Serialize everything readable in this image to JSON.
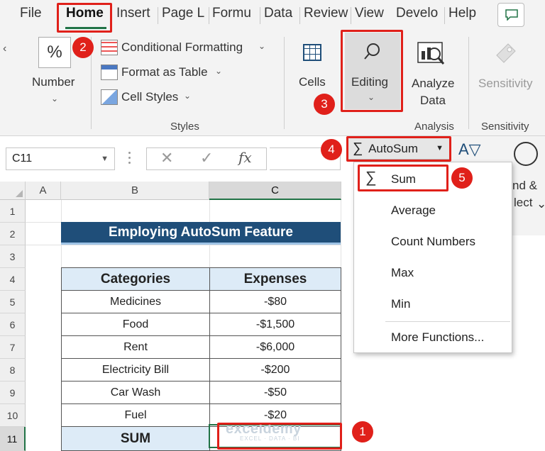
{
  "ribbon_tabs": [
    "File",
    "Home",
    "Insert",
    "Page L",
    "Formu",
    "Data",
    "Review",
    "View",
    "Develo",
    "Help"
  ],
  "ribbon": {
    "number_symbol": "%",
    "number_label": "Number",
    "conditional_formatting": "Conditional Formatting",
    "format_as_table": "Format as Table",
    "cell_styles": "Cell Styles",
    "styles_group": "Styles",
    "cells_label": "Cells",
    "editing_label": "Editing",
    "analyze_label_1": "Analyze",
    "analyze_label_2": "Data",
    "analysis_group": "Analysis",
    "sensitivity_label": "Sensitivity",
    "sensitivity_group": "Sensitivity"
  },
  "formula_bar": {
    "name_box": "C11",
    "cancel_symbol": "✕",
    "enter_symbol": "✓",
    "fx_symbol": "fx",
    "formula": ""
  },
  "columns": [
    "A",
    "B",
    "C"
  ],
  "rows": [
    "1",
    "2",
    "3",
    "4",
    "5",
    "6",
    "7",
    "8",
    "9",
    "10",
    "11"
  ],
  "sheet": {
    "title": "Employing AutoSum Feature",
    "headers": [
      "Categories",
      "Expenses"
    ],
    "items": [
      {
        "category": "Medicines",
        "expense": "-$80"
      },
      {
        "category": "Food",
        "expense": "-$1,500"
      },
      {
        "category": "Rent",
        "expense": "-$6,000"
      },
      {
        "category": "Electricity Bill",
        "expense": "-$200"
      },
      {
        "category": "Car Wash",
        "expense": "-$50"
      },
      {
        "category": "Fuel",
        "expense": "-$20"
      }
    ],
    "sum_label": "SUM",
    "sum_value": ""
  },
  "autosum": {
    "symbol": "∑",
    "label": "AutoSum",
    "menu": [
      "Sum",
      "Average",
      "Count Numbers",
      "Max",
      "Min",
      "More Functions..."
    ]
  },
  "peek": {
    "find_line1": "nd &",
    "find_line2": "lect"
  },
  "watermark": {
    "main": "exceldemy",
    "sub": "EXCEL · DATA · BI"
  },
  "badges": [
    "1",
    "2",
    "3",
    "4",
    "5"
  ],
  "colors": {
    "highlight": "#e0201a",
    "title_bg": "#1f4e79",
    "header_bg": "#ddebf7",
    "excel_green": "#217346"
  }
}
